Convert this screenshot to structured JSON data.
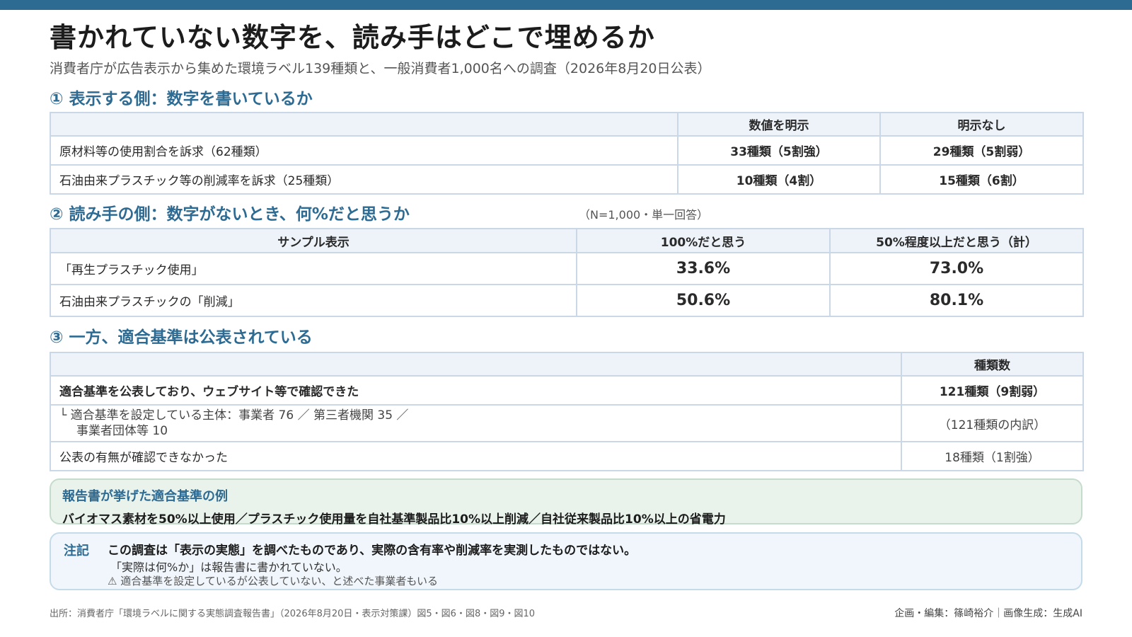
{
  "header": {
    "title": "書かれていない数字を、読み手はどこで埋めるか",
    "subtitle": "消費者庁が広告表示から集めた環境ラベル139種類と、一般消費者1,000名への調査（2026年8月20日公表）"
  },
  "section1": {
    "heading": "① 表示する側：数字を書いているか",
    "columns": [
      "",
      "数値を明示",
      "明示なし"
    ],
    "rows": [
      {
        "label": "原材料等の使用割合を訴求（62種類）",
        "explicit": "33種類（5割強）",
        "none": "29種類（5割弱）"
      },
      {
        "label": "石油由来プラスチック等の削減率を訴求（25種類）",
        "explicit": "10種類（4割）",
        "none": "15種類（6割）"
      }
    ]
  },
  "section2": {
    "heading": "② 読み手の側：数字がないとき、何%だと思うか",
    "note": "（N=1,000・単一回答）",
    "columns": [
      "サンプル表示",
      "100%だと思う",
      "50%程度以上だと思う（計）"
    ],
    "rows": [
      {
        "label": "「再生プラスチック使用」",
        "pct100": "33.6%",
        "pct50": "73.0%"
      },
      {
        "label": "石油由来プラスチックの「削減」",
        "pct100": "50.6%",
        "pct50": "80.1%"
      }
    ]
  },
  "section3": {
    "heading": "③ 一方、適合基準は公表されている",
    "columns": [
      "",
      "種類数"
    ],
    "rows": [
      {
        "label": "適合基準を公表しており、ウェブサイト等で確認できた",
        "value": "121種類（9割弱）"
      },
      {
        "label_line1": "└ 適合基準を設定している主体：事業者 76 ／ 第三者機関 35 ／",
        "label_line2": "事業者団体等 10",
        "value": "（121種類の内訳）"
      },
      {
        "label": "公表の有無が確認できなかった",
        "value": "18種類（1割強）"
      }
    ]
  },
  "example": {
    "title": "報告書が挙げた適合基準の例",
    "text": "バイオマス素材を50%以上使用／プラスチック使用量を自社基準製品比10%以上削減／自社従来製品比10%以上の省電力"
  },
  "note": {
    "label": "注記",
    "main": "この調査は「表示の実態」を調べたものであり、実際の含有率や削減率を実測したものではない。",
    "line2": "「実際は何%か」は報告書に書かれていない。",
    "line3": "⚠ 適合基準を設定しているが公表していない、と述べた事業者もいる"
  },
  "footer": {
    "source": "出所：消費者庁「環境ラベルに関する実態調査報告書」（2026年8月20日・表示対策課）図5・図6・図8・図9・図10",
    "credit": "企画・編集：篠崎裕介｜画像生成：生成AI"
  },
  "colors": {
    "accent": "#2e6b93",
    "table_border": "#c9d7e6",
    "header_fill": "#edf3f9",
    "example_fill": "#e9f3ec",
    "note_fill": "#f0f6fb"
  }
}
